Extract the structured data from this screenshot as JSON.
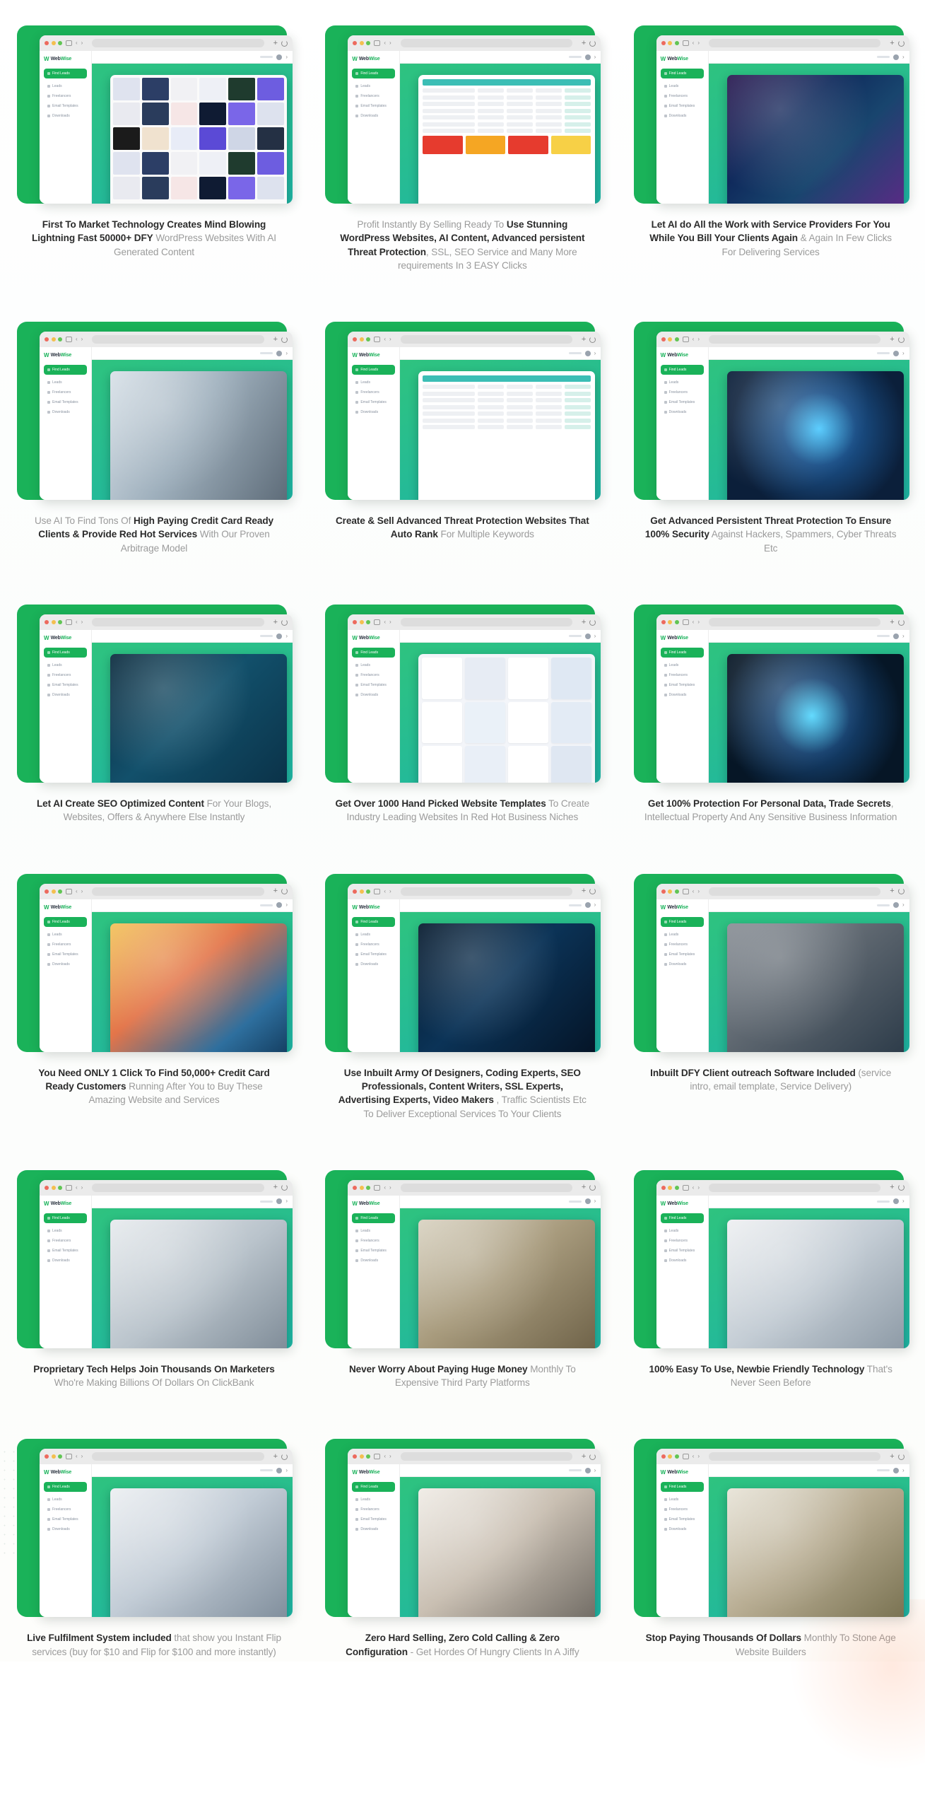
{
  "brand": {
    "name": "WebWise",
    "accent_green": "#1ab259",
    "accent_teal": "#19b3a8",
    "logo_mark": "W"
  },
  "browser_mock": {
    "window_dots": [
      "red",
      "yellow",
      "green"
    ],
    "url_placeholder": "",
    "sidebar": {
      "active_item": "Find Leads",
      "items": [
        "Leads",
        "Freelancers",
        "Email Templates",
        "Downloads"
      ]
    },
    "topbar": {
      "user_label": ""
    }
  },
  "features": [
    {
      "id": "first-to-market",
      "art": "dfy-templates-grid",
      "parts": [
        {
          "text": "First To Market Technology Creates Mind Blowing Lightning Fast 50000+ DFY",
          "bold": true
        },
        {
          "text": " WordPress Websites With AI Generated Content",
          "bold": false
        }
      ]
    },
    {
      "id": "profit-instantly",
      "art": "dashboard-table",
      "parts": [
        {
          "text": "Profit Instantly By Selling Ready To ",
          "bold": false
        },
        {
          "text": "Use Stunning WordPress Websites, AI Content, Advanced persistent Threat Protection",
          "bold": true
        },
        {
          "text": ", SSL, SEO Service and Many More requirements In 3 EASY Clicks",
          "bold": false
        }
      ]
    },
    {
      "id": "let-ai-do-work",
      "art": "ai-circuit",
      "parts": [
        {
          "text": "Let AI do All the Work with Service Providers For You While You Bill Your Clients Again",
          "bold": true
        },
        {
          "text": " & Again In Few Clicks For Delivering Services",
          "bold": false
        }
      ]
    },
    {
      "id": "high-paying-clients",
      "art": "credit-card-hands",
      "parts": [
        {
          "text": "Use AI To Find Tons Of ",
          "bold": false
        },
        {
          "text": "High Paying Credit Card Ready Clients & Provide Red Hot Services",
          "bold": true
        },
        {
          "text": " With Our Proven Arbitrage Model",
          "bold": false
        }
      ]
    },
    {
      "id": "threat-protection-sites",
      "art": "table-rows",
      "parts": [
        {
          "text": "Create & Sell Advanced Threat Protection Websites That Auto Rank",
          "bold": true
        },
        {
          "text": " For Multiple Keywords",
          "bold": false
        }
      ]
    },
    {
      "id": "advanced-persistent",
      "art": "shield-man",
      "parts": [
        {
          "text": "Get Advanced Persistent Threat Protection To Ensure 100% Security",
          "bold": true
        },
        {
          "text": " Against Hackers, Spammers, Cyber Threats Etc",
          "bold": false
        }
      ]
    },
    {
      "id": "seo-content",
      "art": "seo-laptop",
      "parts": [
        {
          "text": "Let AI Create SEO Optimized Content",
          "bold": true
        },
        {
          "text": " For Your Blogs, Websites, Offers & Anywhere Else Instantly",
          "bold": false
        }
      ]
    },
    {
      "id": "1000-templates",
      "art": "template-gallery",
      "parts": [
        {
          "text": "Get Over 1000 Hand Picked Website Templates",
          "bold": true
        },
        {
          "text": " To Create Industry Leading Websites In Red Hot Business Niches",
          "bold": false
        }
      ]
    },
    {
      "id": "personal-data-protection",
      "art": "shield-tablet",
      "parts": [
        {
          "text": "Get 100% Protection For Personal Data, Trade Secrets",
          "bold": true
        },
        {
          "text": ", Intellectual Property And Any Sensitive Business Information",
          "bold": false
        }
      ]
    },
    {
      "id": "one-click-customers",
      "art": "web-design-desk",
      "parts": [
        {
          "text": "You Need ONLY 1 Click To Find 50,000+ Credit Card Ready Customers",
          "bold": true
        },
        {
          "text": " Running After You to Buy These Amazing Website and Services",
          "bold": false
        }
      ]
    },
    {
      "id": "inbuilt-army",
      "art": "code-matrix",
      "parts": [
        {
          "text": "Use Inbuilt Army Of Designers, Coding Experts, SEO Professionals, Content Writers, SSL Experts, Advertising Experts, Video Makers",
          "bold": true
        },
        {
          "text": " , Traffic Scientists Etc To Deliver Exceptional Services To Your Clients",
          "bold": false
        }
      ]
    },
    {
      "id": "dfy-outreach",
      "art": "software-dev-tablet",
      "parts": [
        {
          "text": "Inbuilt DFY Client outreach Software Included",
          "bold": true
        },
        {
          "text": " (service intro, email template, Service Delivery)",
          "bold": false
        }
      ]
    },
    {
      "id": "proprietary-tech",
      "art": "team-people",
      "parts": [
        {
          "text": "Proprietary Tech Helps Join Thousands On Marketers",
          "bold": true
        },
        {
          "text": " Who're Making Billions Of Dollars On ClickBank",
          "bold": false
        }
      ]
    },
    {
      "id": "never-worry-money",
      "art": "cash-hands",
      "parts": [
        {
          "text": "Never Worry About Paying Huge Money",
          "bold": true
        },
        {
          "text": " Monthly To Expensive Third Party Platforms",
          "bold": false
        }
      ]
    },
    {
      "id": "newbie-friendly",
      "art": "friends-laptop",
      "parts": [
        {
          "text": "100% Easy To Use, Newbie Friendly Technology",
          "bold": true
        },
        {
          "text": " That's Never Seen Before",
          "bold": false
        }
      ]
    },
    {
      "id": "live-fulfilment",
      "art": "meeting-room",
      "parts": [
        {
          "text": "Live Fulfilment System included",
          "bold": true
        },
        {
          "text": " that show you Instant Flip services (buy for $10 and Flip for $100 and more instantly)",
          "bold": false
        }
      ]
    },
    {
      "id": "zero-hard-selling",
      "art": "conference-room",
      "parts": [
        {
          "text": "Zero Hard Selling, Zero Cold Calling & Zero Configuration",
          "bold": true
        },
        {
          "text": " - Get Hordes Of Hungry Clients In A Jiffy",
          "bold": false
        }
      ]
    },
    {
      "id": "stop-paying-thousands",
      "art": "money-calculator",
      "parts": [
        {
          "text": "Stop Paying Thousands Of Dollars",
          "bold": true
        },
        {
          "text": " Monthly To Stone Age Website Builders",
          "bold": false
        }
      ]
    }
  ]
}
